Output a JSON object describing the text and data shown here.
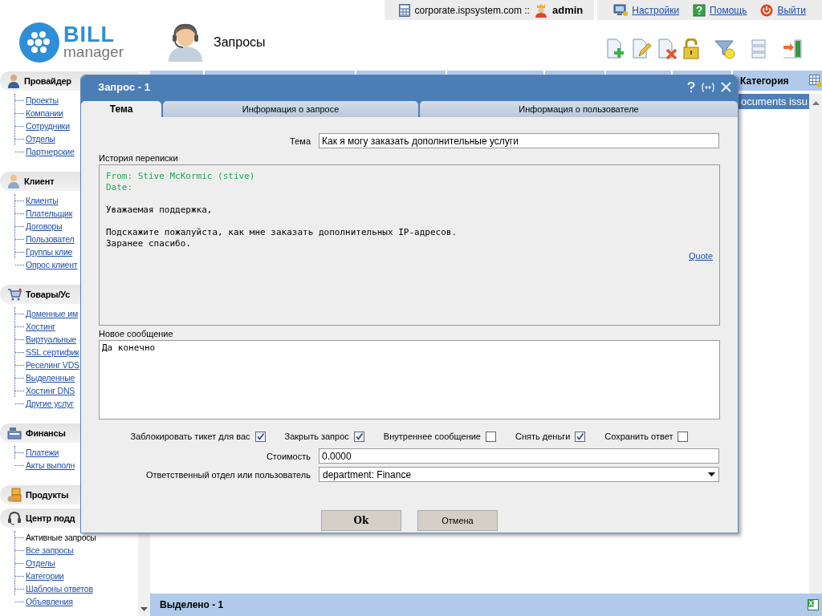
{
  "top_bar": {
    "host": "corporate.ispsystem.com ::",
    "user": "admin",
    "links": [
      "Настройки",
      "Помощь",
      "Выйти"
    ]
  },
  "logo": {
    "word_1": "BILL",
    "word_2": "manager"
  },
  "page_title": "Запросы",
  "sidebar": [
    {
      "title": "Провайдер",
      "items": [
        {
          "label": "Проекты",
          "selected": false
        },
        {
          "label": "Компании",
          "selected": false
        },
        {
          "label": "Сотрудники",
          "selected": false
        },
        {
          "label": "Отделы",
          "selected": false
        },
        {
          "label": "Партнерские",
          "selected": false
        }
      ]
    },
    {
      "title": "Клиент",
      "items": [
        {
          "label": "Клиенты",
          "selected": false
        },
        {
          "label": "Плательщик",
          "selected": false
        },
        {
          "label": "Договоры",
          "selected": false
        },
        {
          "label": "Пользовател",
          "selected": false
        },
        {
          "label": "Группы клие",
          "selected": false
        },
        {
          "label": "Опрос клиент",
          "selected": false
        }
      ]
    },
    {
      "title": "Товары/Ус",
      "items": [
        {
          "label": "Доменные им",
          "selected": false
        },
        {
          "label": "Хостинг",
          "selected": false
        },
        {
          "label": "Виртуальные",
          "selected": false
        },
        {
          "label": "SSL сертифик",
          "selected": false
        },
        {
          "label": "Реселинг VDS",
          "selected": false
        },
        {
          "label": "Выделенные",
          "selected": false
        },
        {
          "label": "Хостинг DNS",
          "selected": false
        },
        {
          "label": "Другие услуг",
          "selected": false
        }
      ]
    },
    {
      "title": "Финансы",
      "items": [
        {
          "label": "Платежи",
          "selected": false
        },
        {
          "label": "Акты выполн",
          "selected": false
        }
      ]
    },
    {
      "title": "Продукты"
    },
    {
      "title": "Центр подд",
      "items": [
        {
          "label": "Активные запросы",
          "selected": true
        },
        {
          "label": "Все запросы",
          "selected": false
        },
        {
          "label": "Отделы",
          "selected": false
        },
        {
          "label": "Категории",
          "selected": false
        },
        {
          "label": "Шаблоны ответов",
          "selected": false
        },
        {
          "label": "Объявления",
          "selected": false
        }
      ]
    }
  ],
  "table": {
    "column_header": "Категория",
    "rows": [
      {
        "cell": "ocuments issu",
        "selected": true
      }
    ]
  },
  "status_bar": "Выделено - 1",
  "dialog": {
    "title": "Запрос - 1",
    "tabs": [
      {
        "label": "Тема",
        "selected": true
      },
      {
        "label": "Информация о запросе",
        "selected": false
      },
      {
        "label": "Информация о пользователе",
        "selected": false
      }
    ],
    "subject": {
      "label": "Тема",
      "value": "Как я могу заказать дополнительные услуги"
    },
    "history": {
      "label": "История переписки",
      "from": "From: Stive McKormic (stive)",
      "date": "Date:",
      "body": [
        "Уважаемая поддержка,",
        "Подскажите пожалуйста, как мне заказать дополнительных IP-адресов.",
        "Заранее спасибо."
      ],
      "quote": "Quote"
    },
    "new_message": {
      "label": "Новое сообщение",
      "value": "Да конечно"
    },
    "checkboxes": [
      {
        "label": "Заблокировать тикет для вас",
        "checked": true
      },
      {
        "label": "Закрыть запрос",
        "checked": true
      },
      {
        "label": "Внутреннее сообщение",
        "checked": false
      },
      {
        "label": "Снять деньги",
        "checked": true
      },
      {
        "label": "Сохранить ответ",
        "checked": false
      }
    ],
    "cost": {
      "label": "Стоимость",
      "value": "0.0000"
    },
    "responsible": {
      "label": "Ответственный отдел или пользователь",
      "value": "department: Finance"
    },
    "buttons": [
      "Ok",
      "Отмена"
    ]
  }
}
